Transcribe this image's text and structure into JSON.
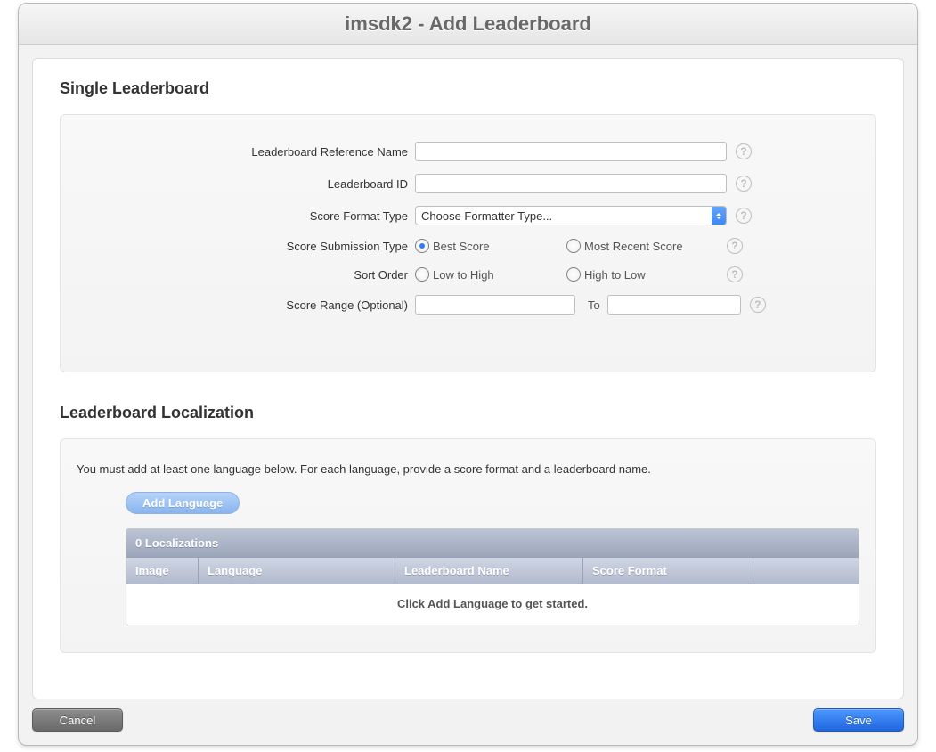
{
  "title": "imsdk2 - Add Leaderboard",
  "sections": {
    "single": {
      "title": "Single Leaderboard",
      "fields": {
        "ref_name_label": "Leaderboard Reference Name",
        "ref_name_value": "",
        "id_label": "Leaderboard ID",
        "id_value": "",
        "format_type_label": "Score Format Type",
        "format_type_placeholder": "Choose Formatter Type...",
        "submission_type_label": "Score Submission Type",
        "submission_best": "Best Score",
        "submission_recent": "Most Recent Score",
        "sort_order_label": "Sort Order",
        "sort_low_high": "Low to High",
        "sort_high_low": "High to Low",
        "score_range_label": "Score Range (Optional)",
        "score_range_to": "To",
        "score_range_from_value": "",
        "score_range_to_value": ""
      }
    },
    "localization": {
      "title": "Leaderboard Localization",
      "description": "You must add at least one language below. For each language, provide a score format and a leaderboard name.",
      "add_button": "Add Language",
      "table": {
        "count_header": "0 Localizations",
        "cols": {
          "image": "Image",
          "language": "Language",
          "name": "Leaderboard Name",
          "score_format": "Score Format"
        },
        "empty": "Click Add Language to get started."
      }
    }
  },
  "footer": {
    "cancel": "Cancel",
    "save": "Save"
  }
}
